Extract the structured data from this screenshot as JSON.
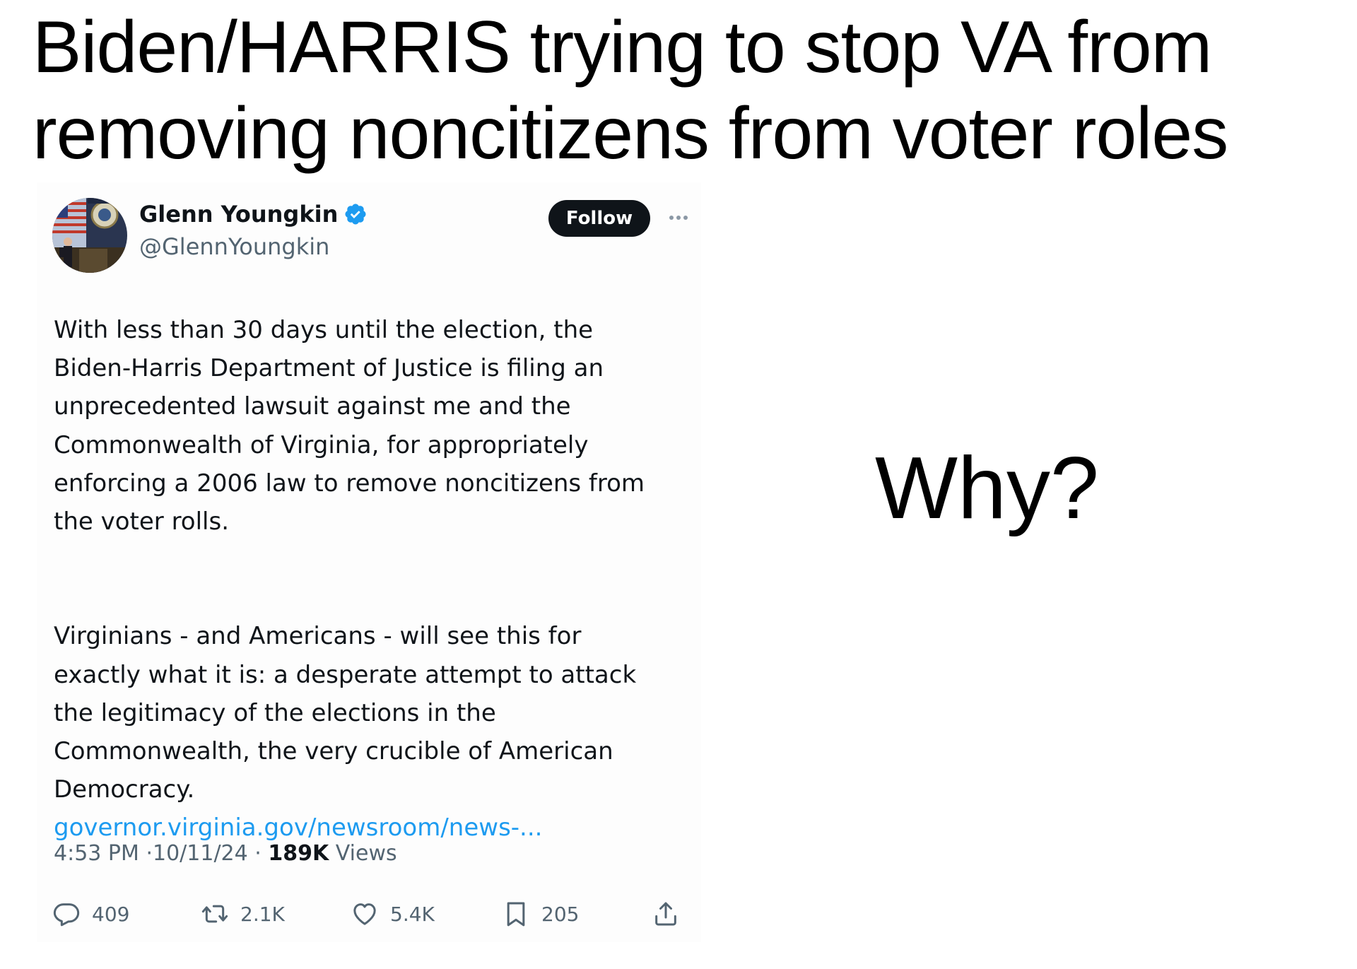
{
  "caption": {
    "line1": "Biden/HARRIS trying to stop VA from",
    "line2": "removing noncitizens from voter roles"
  },
  "tweet": {
    "author_name": "Glenn Youngkin",
    "author_handle": "@GlennYoungkin",
    "follow_label": "Follow",
    "paragraph1": "With less than 30 days until the election, the\nBiden-Harris Department of Justice is filing an\nunprecedented lawsuit against me and the\nCommonwealth of Virginia, for appropriately\nenforcing a 2006 law to remove noncitizens from\nthe voter rolls.",
    "paragraph2": "Virginians - and Americans - will see this for\nexactly what it is: a desperate attempt to attack\nthe legitimacy of the elections in the\nCommonwealth, the very crucible of American\nDemocracy.",
    "link_text": "governor.virginia.gov/newsroom/news-...",
    "time": "4:53 PM",
    "date": "10/11/24",
    "views_count": "189K",
    "views_label": "Views",
    "separator": "·",
    "replies": "409",
    "reposts": "2.1K",
    "likes": "5.4K",
    "bookmarks": "205"
  },
  "side_text": "Why?",
  "icons": {
    "verified": "verified-badge-icon",
    "more": "more-dots-icon",
    "reply": "reply-bubble-icon",
    "repost": "repost-arrows-icon",
    "like": "heart-icon",
    "bookmark": "bookmark-icon",
    "share": "share-upload-icon"
  },
  "colors": {
    "verified_blue": "#1d9bf0",
    "link_blue": "#1d9bf0",
    "secondary_text": "#536471",
    "primary_text": "#0f1419",
    "follow_button_bg": "#0f1419"
  }
}
